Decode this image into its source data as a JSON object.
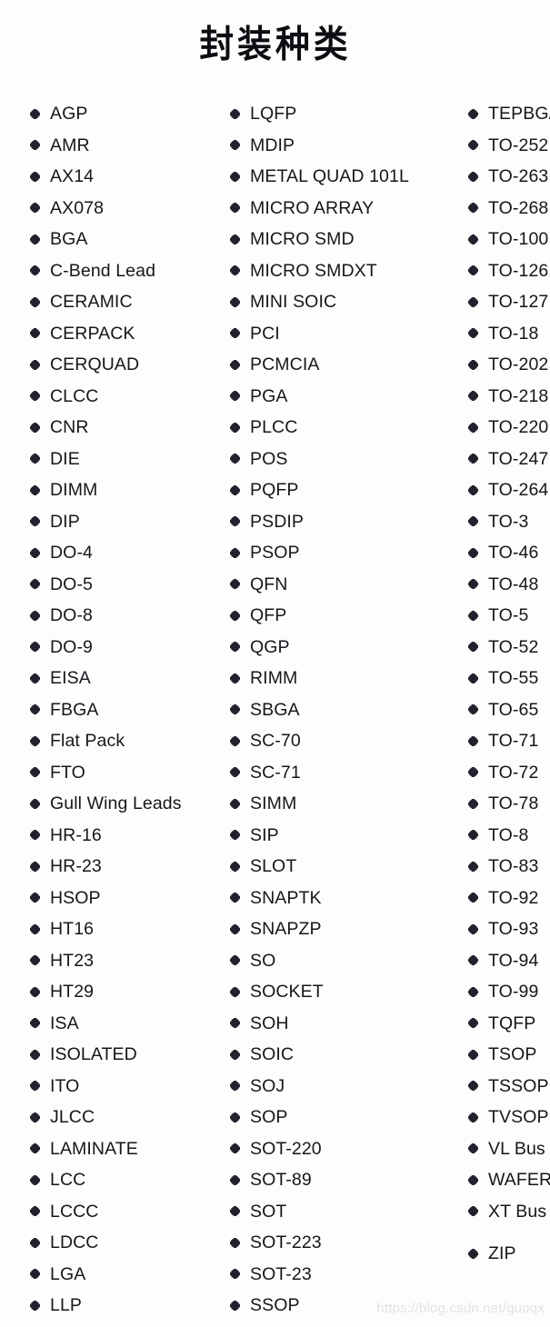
{
  "page": {
    "title": "封装种类",
    "background_color": "#fdfdfd",
    "text_color": "#16161c",
    "bullet_color": "#22222e",
    "bullet_icon": "flower-bullet-icon"
  },
  "watermark": {
    "text": "https://blog.csdn.net/guoqx",
    "color": "#e2e2e6"
  },
  "columns": [
    {
      "name": "column-1",
      "items": [
        "AGP",
        "AMR",
        "AX14",
        "AX078",
        "BGA",
        "C-Bend Lead",
        "CERAMIC",
        "CERPACK",
        "CERQUAD",
        "CLCC",
        "CNR",
        "DIE",
        "DIMM",
        "DIP",
        "DO-4",
        "DO-5",
        "DO-8",
        "DO-9",
        "EISA",
        "FBGA",
        "Flat Pack",
        "FTO",
        "Gull Wing Leads",
        "HR-16",
        "HR-23",
        "HSOP",
        "HT16",
        "HT23",
        "HT29",
        "ISA",
        "ISOLATED",
        "ITO",
        "JLCC",
        "LAMINATE",
        "LCC",
        "LCCC",
        "LDCC",
        "LGA",
        "LLP"
      ]
    },
    {
      "name": "column-2",
      "items": [
        "LQFP",
        "MDIP",
        "METAL QUAD 101L",
        "MICRO ARRAY",
        "MICRO SMD",
        "MICRO SMDXT",
        "MINI SOIC",
        "PCI",
        "PCMCIA",
        "PGA",
        "PLCC",
        "POS",
        "PQFP",
        "PSDIP",
        "PSOP",
        "QFN",
        "QFP",
        "QGP",
        "RIMM",
        "SBGA",
        "SC-70",
        "SC-71",
        "SIMM",
        "SIP",
        "SLOT",
        "SNAPTK",
        "SNAPZP",
        "SO",
        "SOCKET",
        "SOH",
        "SOIC",
        "SOJ",
        "SOP",
        "SOT-220",
        "SOT-89",
        "SOT",
        "SOT-223",
        "SOT-23",
        "SSOP"
      ]
    },
    {
      "name": "column-3",
      "items": [
        "TEPBGA",
        "TO-252",
        "TO-263",
        "TO-268",
        "TO-100",
        "TO-126",
        "TO-127",
        "TO-18",
        "TO-202",
        "TO-218",
        "TO-220",
        "TO-247",
        "TO-264",
        "TO-3",
        "TO-46",
        "TO-48",
        "TO-5",
        "TO-52",
        "TO-55",
        "TO-65",
        "TO-71",
        "TO-72",
        "TO-78",
        "TO-8",
        "TO-83",
        "TO-92",
        "TO-93",
        "TO-94",
        "TO-99",
        "TQFP",
        "TSOP",
        "TSSOP",
        "TVSOP",
        "VL Bus",
        "WAFER",
        "XT Bus",
        "ZIP"
      ]
    }
  ]
}
